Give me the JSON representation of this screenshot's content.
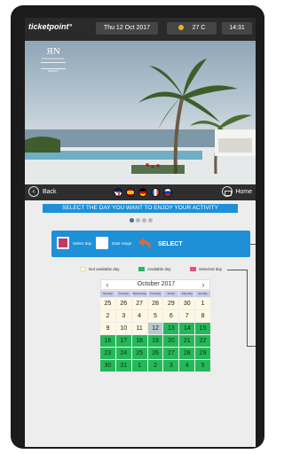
{
  "header": {
    "brand": "ticketpoint°",
    "date": "Thu 12 Oct 2017",
    "temperature": "27 C",
    "time": "14:31",
    "weather_icon": "sun-icon"
  },
  "hero": {
    "hotel_monogram": "ЯN",
    "hotel_name": "ROCAMATANSA",
    "hotel_subtitle": "RESORT"
  },
  "nav": {
    "back_label": "Back",
    "home_label": "Home",
    "languages": [
      "en",
      "es",
      "de",
      "fr",
      "ru"
    ]
  },
  "instruction": "SELECT THE DAY YOU WANT TO ENJOY YOUR ACTIVITY",
  "pager": {
    "pages": 4,
    "active": 0
  },
  "select_panel": {
    "select_day_label": "Select day",
    "date_range_label": "Date range",
    "select_label": "SELECT",
    "select_day_checked": true,
    "date_range_checked": false
  },
  "legend": {
    "not_available": "Not available day",
    "available": "Available day",
    "selected": "Selected day"
  },
  "colors": {
    "accent_blue": "#1e90d8",
    "available_green": "#25b85a",
    "selected_pink": "#e0557d",
    "not_available_cream": "#fdf7e3",
    "arrow_orange": "#e06a2a"
  },
  "calendar": {
    "month_title": "October 2017",
    "day_names": [
      "Monday",
      "Tuesday",
      "Wednesday",
      "Thursday",
      "Friday",
      "Saturday",
      "Sunday"
    ],
    "weeks": [
      [
        {
          "d": "25",
          "s": "na"
        },
        {
          "d": "26",
          "s": "na"
        },
        {
          "d": "27",
          "s": "na"
        },
        {
          "d": "28",
          "s": "na"
        },
        {
          "d": "29",
          "s": "na"
        },
        {
          "d": "30",
          "s": "na"
        },
        {
          "d": "1",
          "s": "na"
        }
      ],
      [
        {
          "d": "2",
          "s": "na"
        },
        {
          "d": "3",
          "s": "na"
        },
        {
          "d": "4",
          "s": "na"
        },
        {
          "d": "5",
          "s": "na"
        },
        {
          "d": "6",
          "s": "na"
        },
        {
          "d": "7",
          "s": "na"
        },
        {
          "d": "8",
          "s": "na"
        }
      ],
      [
        {
          "d": "9",
          "s": "na"
        },
        {
          "d": "10",
          "s": "na"
        },
        {
          "d": "11",
          "s": "na"
        },
        {
          "d": "12",
          "s": "sel"
        },
        {
          "d": "13",
          "s": "av"
        },
        {
          "d": "14",
          "s": "av"
        },
        {
          "d": "15",
          "s": "av"
        }
      ],
      [
        {
          "d": "16",
          "s": "av"
        },
        {
          "d": "17",
          "s": "av"
        },
        {
          "d": "18",
          "s": "av"
        },
        {
          "d": "19",
          "s": "av"
        },
        {
          "d": "20",
          "s": "av"
        },
        {
          "d": "21",
          "s": "av"
        },
        {
          "d": "22",
          "s": "av"
        }
      ],
      [
        {
          "d": "23",
          "s": "av"
        },
        {
          "d": "24",
          "s": "av"
        },
        {
          "d": "25",
          "s": "av"
        },
        {
          "d": "26",
          "s": "av"
        },
        {
          "d": "27",
          "s": "av"
        },
        {
          "d": "28",
          "s": "av"
        },
        {
          "d": "29",
          "s": "av"
        }
      ],
      [
        {
          "d": "30",
          "s": "av"
        },
        {
          "d": "31",
          "s": "av"
        },
        {
          "d": "1",
          "s": "av"
        },
        {
          "d": "2",
          "s": "av"
        },
        {
          "d": "3",
          "s": "av"
        },
        {
          "d": "4",
          "s": "av"
        },
        {
          "d": "5",
          "s": "av"
        }
      ]
    ]
  }
}
